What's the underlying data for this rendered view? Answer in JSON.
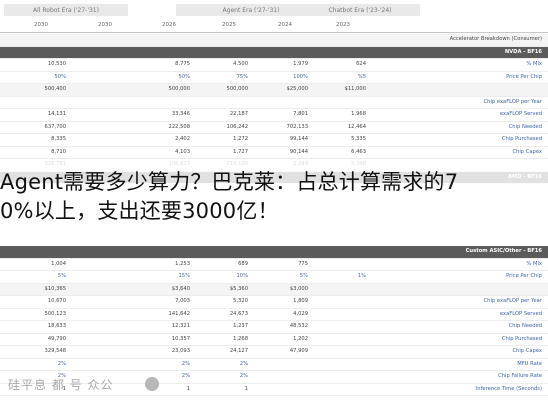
{
  "header": {
    "band_left": "All Robot Era ('27-'31)",
    "band_mid": "Agent Era ('27-'31)",
    "band_right": "Chatbot Era ('23-'24)",
    "years": [
      "2030",
      "2030",
      "2026",
      "2025",
      "2024",
      "2023"
    ]
  },
  "section_title": "Accelerator Breakdown (Consumer)",
  "headline": {
    "line1": "Agent需要多少算力？巴克莱：占总计算需求的7",
    "line2": "0%以上，支出还要3000亿！"
  },
  "watermark": "硅平息 都  号 众公 ",
  "table": {
    "top_rows": [
      {
        "label": "NVDA - BF16",
        "type": "dark",
        "cells": [
          "",
          "",
          "",
          "",
          "",
          ""
        ]
      },
      {
        "label": "% Mix",
        "type": "plain",
        "cells": [
          "10,530",
          "",
          "8,775",
          "4,500",
          "1,979",
          "624"
        ]
      },
      {
        "label": "Price Per Chip",
        "type": "plain",
        "cells": [
          "50%",
          "",
          "50%",
          "75%",
          "100%",
          "%5"
        ]
      },
      {
        "label": "",
        "type": "section",
        "cells": [
          "500,400",
          "",
          "500,000",
          "500,000",
          "$25,000",
          "$11,000"
        ]
      },
      {
        "label": "Chip exaFLOP per Year",
        "type": "plain",
        "cells": [
          "",
          "",
          "",
          "",
          "",
          ""
        ]
      },
      {
        "label": "exaFLOP Served",
        "type": "plain",
        "cells": [
          "14,131",
          "",
          "33,346",
          "22,187",
          "7,801",
          "1,968"
        ]
      },
      {
        "label": "Chip Needed",
        "type": "plain",
        "cells": [
          "637,700",
          "",
          "222,508",
          "106,242",
          "702,133",
          "12,464"
        ]
      },
      {
        "label": "Chip Purchased",
        "type": "plain",
        "cells": [
          "8,335",
          "",
          "2,402",
          "1,272",
          "99,144",
          "5,335"
        ]
      },
      {
        "label": "Chip Capex",
        "type": "plain",
        "cells": [
          "8,710",
          "",
          "4,103",
          "1,727",
          "90,144",
          "6,463"
        ]
      },
      {
        "label": "",
        "type": "plain",
        "cells": [
          "326,781",
          "",
          "106,627",
          "219,190",
          "2,249",
          "5,348"
        ]
      },
      {
        "label": "AMD - BF16",
        "type": "dark",
        "cells": [
          "6,119",
          "",
          "3,022",
          "2,015",
          "",
          ""
        ]
      }
    ],
    "bottom_rows": [
      {
        "label": "Custom ASIC/Other - BF16",
        "type": "dark",
        "cells": [
          "",
          "",
          "",
          "",
          "",
          ""
        ]
      },
      {
        "label": "% Mix",
        "type": "plain",
        "cells": [
          "1,004",
          "",
          "1,253",
          "689",
          "775",
          ""
        ]
      },
      {
        "label": "Price Per Chip",
        "type": "plain",
        "cells": [
          "5%",
          "",
          "15%",
          "10%",
          "5%",
          "1%"
        ]
      },
      {
        "label": "",
        "type": "section",
        "cells": [
          "$10,365",
          "",
          "$3,640",
          "$5,360",
          "$3,000",
          ""
        ]
      },
      {
        "label": "Chip exaFLOP per Year",
        "type": "plain",
        "cells": [
          "10,670",
          "",
          "7,003",
          "5,320",
          "1,809",
          ""
        ]
      },
      {
        "label": "exaFLOP Served",
        "type": "plain",
        "cells": [
          "500,123",
          "",
          "141,642",
          "24,673",
          "4,029",
          ""
        ]
      },
      {
        "label": "Chip Needed",
        "type": "plain",
        "cells": [
          "18,633",
          "",
          "12,321",
          "1,237",
          "48,532",
          ""
        ]
      },
      {
        "label": "Chip Purchased",
        "type": "plain",
        "cells": [
          "49,790",
          "",
          "10,357",
          "1,268",
          "1,202",
          ""
        ]
      },
      {
        "label": "Chip Capex",
        "type": "plain",
        "cells": [
          "329,548",
          "",
          "23,093",
          "24,127",
          "47,909",
          ""
        ]
      },
      {
        "label": "MFU Rate",
        "type": "plain",
        "cells": [
          "2%",
          "",
          "2%",
          "2%",
          "",
          ""
        ]
      },
      {
        "label": "Chip Failure Rate",
        "type": "plain",
        "cells": [
          "2%",
          "",
          "2%",
          "2%",
          "",
          ""
        ]
      },
      {
        "label": "Inference Time (Seconds)",
        "type": "plain",
        "cells": [
          "1",
          "",
          "1",
          "1",
          "",
          ""
        ]
      }
    ]
  }
}
